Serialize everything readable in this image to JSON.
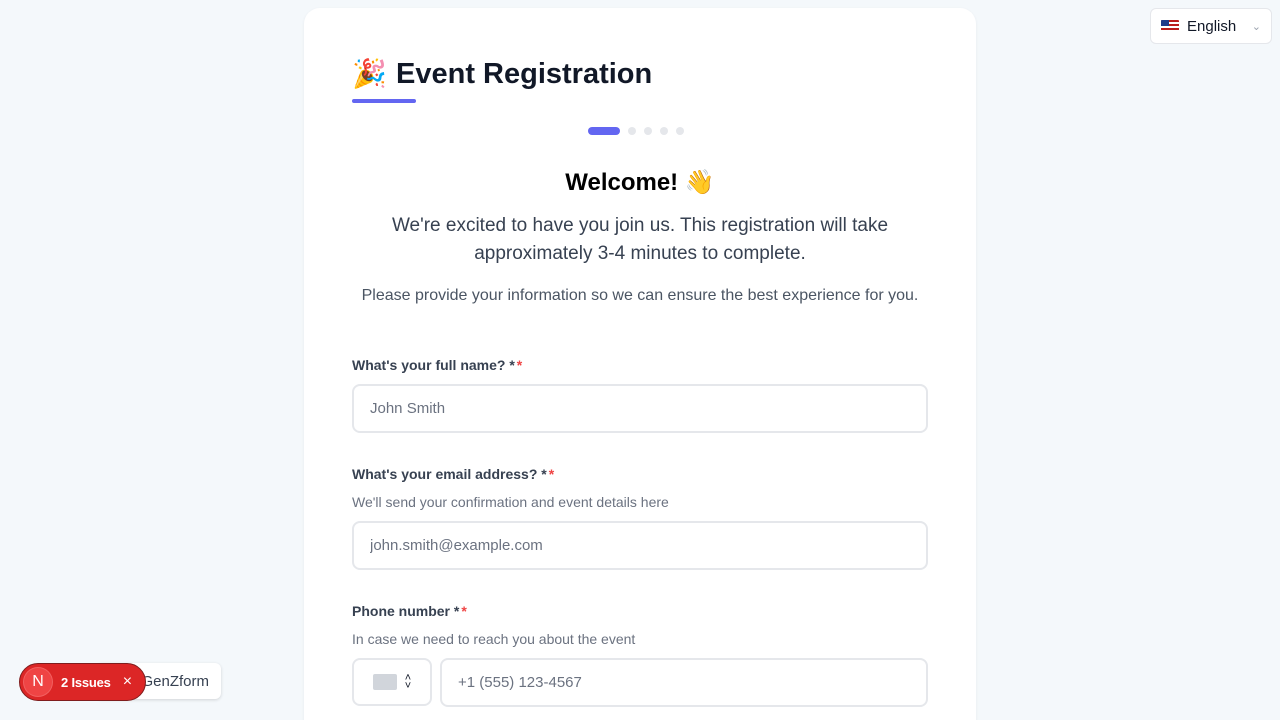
{
  "language": {
    "flag": "us-flag-icon",
    "label": "English",
    "chevron": "chevron-down-icon"
  },
  "form": {
    "title_emoji": "🎉",
    "title": "Event Registration",
    "steps": {
      "current": 1,
      "total": 5
    },
    "welcome": "Welcome! 👋",
    "intro": "We're excited to have you join us. This registration will take approximately 3-4 minutes to complete.",
    "sub_intro": "Please provide your information so we can ensure the best experience for you.",
    "fields": {
      "full_name": {
        "label": "What's your full name? *",
        "required_mark": "*",
        "placeholder": "John Smith",
        "value": ""
      },
      "email": {
        "label": "What's your email address? *",
        "required_mark": "*",
        "help": "We'll send your confirmation and event details here",
        "placeholder": "john.smith@example.com",
        "value": ""
      },
      "phone": {
        "label": "Phone number *",
        "required_mark": "*",
        "help": "In case we need to reach you about the event",
        "placeholder": "+1 (555) 123-4567",
        "value": ""
      }
    }
  },
  "dev_overlay": {
    "logo": "N",
    "issues_label": "2 Issues",
    "close": "×",
    "brand": "GenZform"
  },
  "colors": {
    "accent": "#6366f1",
    "required": "#ef4444",
    "issues_bg": "#dc2626"
  }
}
